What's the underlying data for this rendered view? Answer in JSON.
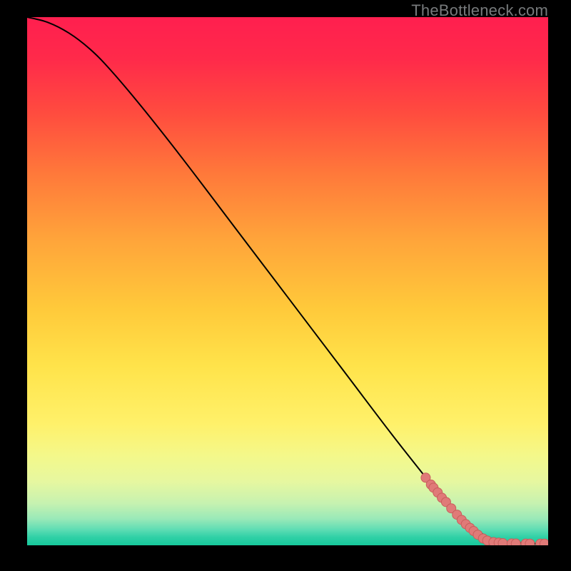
{
  "attribution": "TheBottleneck.com",
  "colors": {
    "curve": "#000000",
    "marker_fill": "#e07a78",
    "marker_stroke": "#c85e5c",
    "background_border": "#000000"
  },
  "chart_data": {
    "type": "line",
    "title": "",
    "xlabel": "",
    "ylabel": "",
    "xlim": [
      0,
      100
    ],
    "ylim": [
      0,
      100
    ],
    "grid": false,
    "series": [
      {
        "name": "curve",
        "x": [
          0,
          4,
          8,
          12,
          16,
          22,
          30,
          40,
          50,
          60,
          70,
          78,
          82,
          86,
          90,
          94,
          98,
          100
        ],
        "y": [
          100,
          99,
          97,
          94,
          90,
          83,
          73,
          60,
          47,
          34,
          21,
          11,
          6,
          3,
          1,
          0.5,
          0.3,
          0.3
        ]
      }
    ],
    "markers": [
      {
        "x": 76.5,
        "y": 12.8
      },
      {
        "x": 77.5,
        "y": 11.5
      },
      {
        "x": 78.0,
        "y": 10.9
      },
      {
        "x": 78.8,
        "y": 10.0
      },
      {
        "x": 79.6,
        "y": 9.0
      },
      {
        "x": 80.4,
        "y": 8.2
      },
      {
        "x": 81.4,
        "y": 7.0
      },
      {
        "x": 82.5,
        "y": 5.8
      },
      {
        "x": 83.4,
        "y": 4.8
      },
      {
        "x": 84.2,
        "y": 4.0
      },
      {
        "x": 85.0,
        "y": 3.3
      },
      {
        "x": 85.7,
        "y": 2.7
      },
      {
        "x": 86.5,
        "y": 2.0
      },
      {
        "x": 87.5,
        "y": 1.3
      },
      {
        "x": 88.3,
        "y": 0.9
      },
      {
        "x": 89.5,
        "y": 0.6
      },
      {
        "x": 90.5,
        "y": 0.5
      },
      {
        "x": 91.3,
        "y": 0.4
      },
      {
        "x": 93.0,
        "y": 0.35
      },
      {
        "x": 93.8,
        "y": 0.33
      },
      {
        "x": 95.7,
        "y": 0.32
      },
      {
        "x": 96.5,
        "y": 0.31
      },
      {
        "x": 98.5,
        "y": 0.3
      },
      {
        "x": 99.3,
        "y": 0.3
      }
    ]
  }
}
